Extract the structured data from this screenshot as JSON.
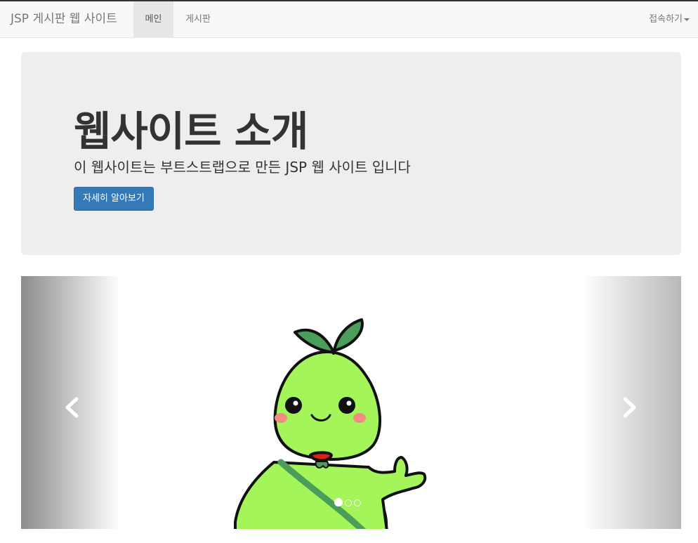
{
  "navbar": {
    "brand": "JSP 게시판 웹 사이트",
    "items": [
      {
        "label": "메인",
        "active": true
      },
      {
        "label": "게시판",
        "active": false
      }
    ],
    "dropdown_label": "접속하기"
  },
  "jumbotron": {
    "title": "웹사이트 소개",
    "text": "이 웹사이트는 부트스트랩으로 만든 JSP 웹 사이트 입니다",
    "button_label": "자세히 알아보기",
    "button_color": "#337ab7"
  },
  "carousel": {
    "slide_count": 3,
    "active_slide": 1,
    "left_control_icon": "chevron-left-icon",
    "right_control_icon": "chevron-right-icon",
    "slide_image": "green-sprout-mascot-illustration"
  },
  "colors": {
    "navbar_bg": "#f8f8f8",
    "jumbotron_bg": "#eeeeee",
    "mascot_green": "#a3f55a",
    "leaf_green": "#4a9e5a"
  }
}
